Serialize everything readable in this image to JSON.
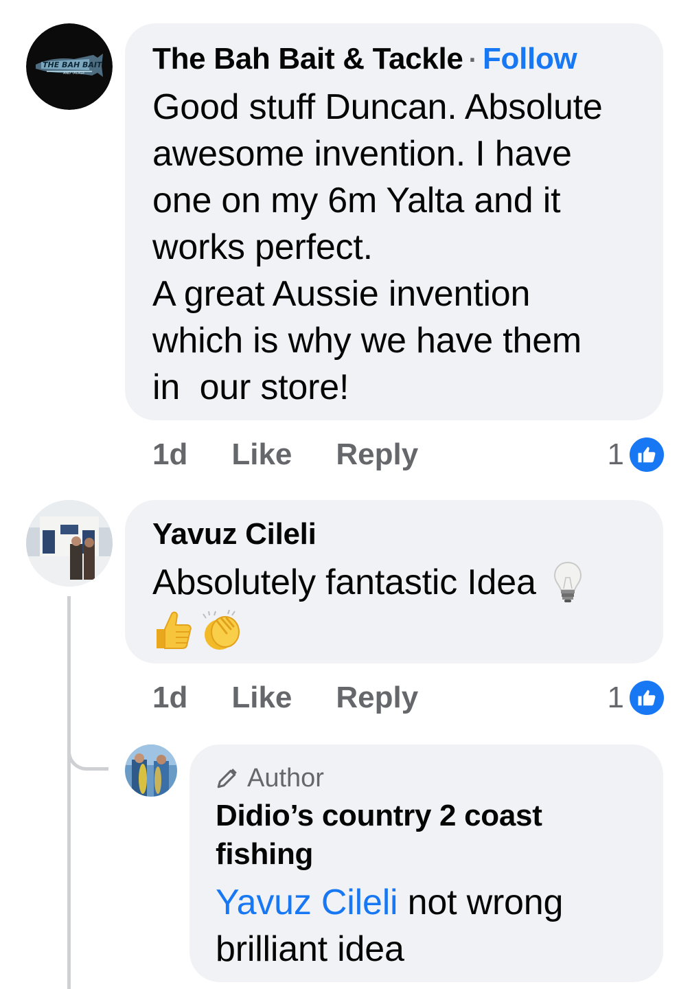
{
  "comments": [
    {
      "author": "The Bah Bait & Tackle",
      "separator": "·",
      "follow_label": "Follow",
      "avatar_logo_text": "THE BAH BAIT",
      "avatar_logo_subtext": "AND TACKLE",
      "text_lines": [
        "Good stuff Duncan. Absolute",
        "awesome invention. I have",
        "one on my 6m Yalta and it",
        "works perfect.",
        "A great Aussie invention",
        "which is why we have them",
        "in  our store!"
      ],
      "time": "1d",
      "like_label": "Like",
      "reply_label": "Reply",
      "reaction_count": "1"
    },
    {
      "author": "Yavuz Cileli",
      "text_line1": "Absolutely fantastic Idea",
      "emoji": [
        "light-bulb",
        "thumbs-up",
        "clapping-hands"
      ],
      "time": "1d",
      "like_label": "Like",
      "reply_label": "Reply",
      "reaction_count": "1"
    }
  ],
  "reply": {
    "badge": "Author",
    "author_line1": "Didio’s country 2 coast",
    "author_line2": "fishing",
    "mention": "Yavuz Cileli",
    "text_after_mention": " not wrong",
    "text_line2": "brilliant idea"
  },
  "colors": {
    "bubble": "#f0f2f5",
    "link": "#1877f2",
    "meta": "#65676b",
    "thread_line": "#ced0d4"
  }
}
